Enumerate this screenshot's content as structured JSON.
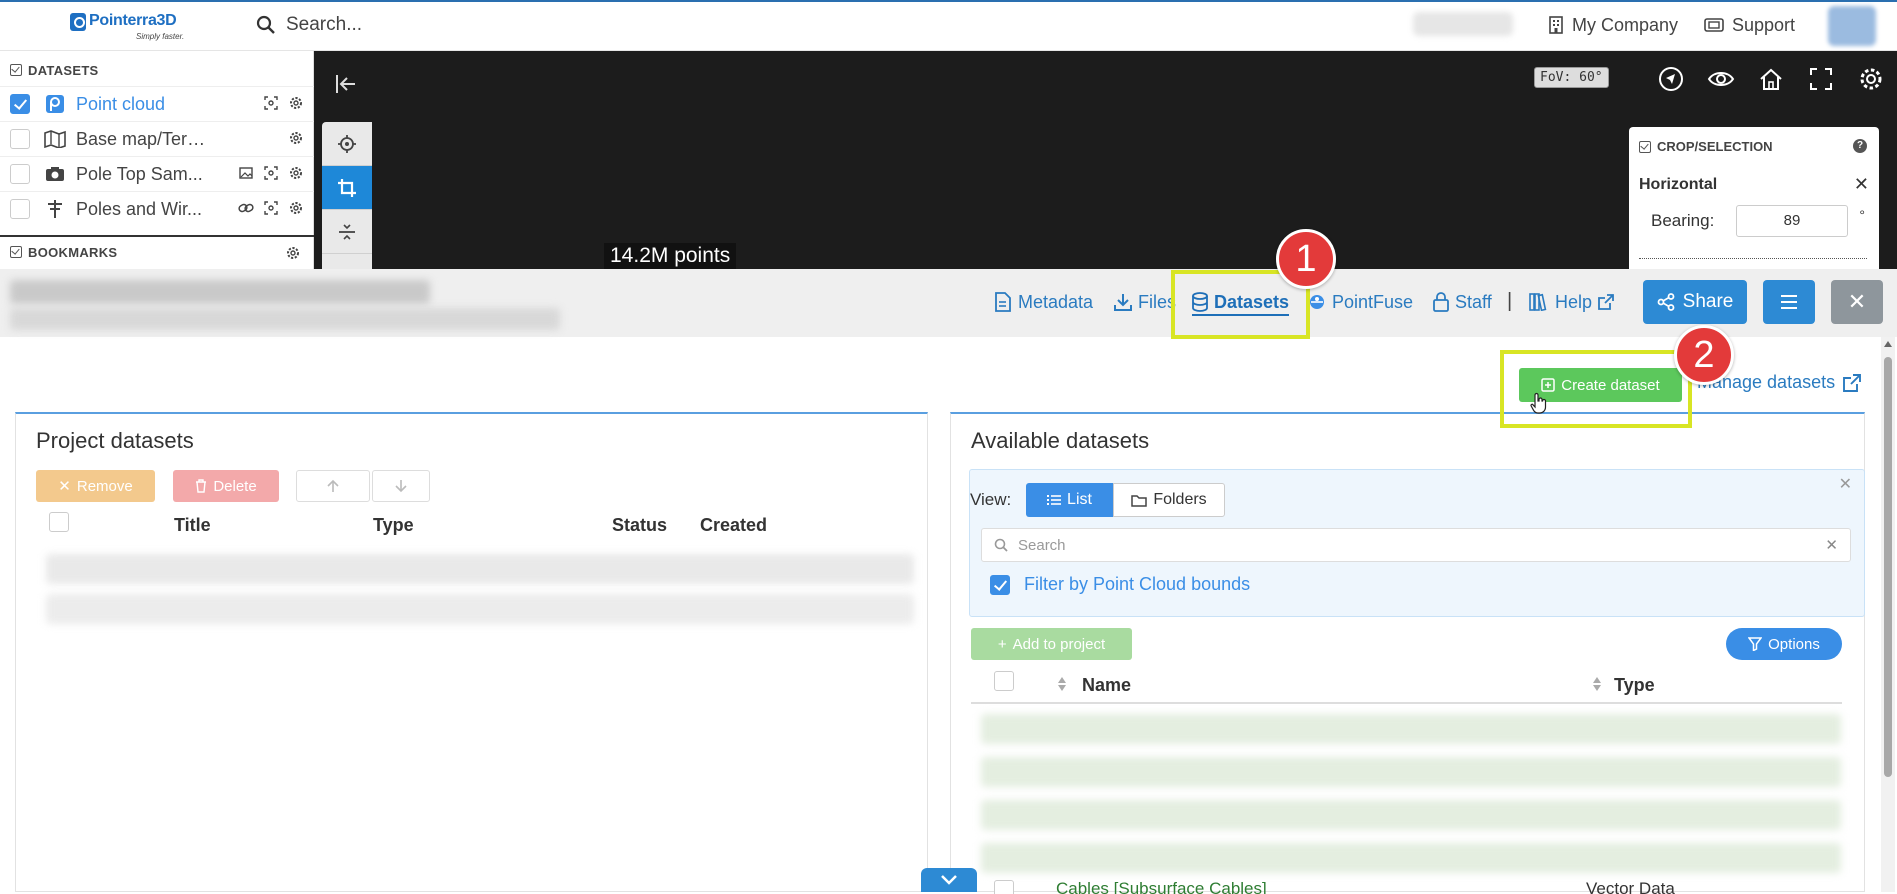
{
  "header": {
    "logo_name": "Pointerra3D",
    "logo_tagline": "Simply faster.",
    "search_placeholder": "Search...",
    "company_label": "My Company",
    "support_label": "Support"
  },
  "left_panel": {
    "datasets_heading": "DATASETS",
    "bookmarks_heading": "BOOKMARKS",
    "items": [
      {
        "label": "Point cloud",
        "checked": true,
        "icon": "point-cloud-icon"
      },
      {
        "label": "Base map/Terrain",
        "checked": false,
        "icon": "map-icon"
      },
      {
        "label": "Pole Top Sam...",
        "checked": false,
        "icon": "camera-icon"
      },
      {
        "label": "Poles and Wir...",
        "checked": false,
        "icon": "pole-icon"
      }
    ]
  },
  "viewer": {
    "points_label": "14.2M points",
    "fov_label": "FoV: 60°",
    "crop": {
      "heading": "CROP/SELECTION",
      "mode": "Horizontal",
      "bearing_label": "Bearing:",
      "bearing_value": "89",
      "bearing_unit": "°"
    }
  },
  "toolbar": {
    "tabs": {
      "metadata": "Metadata",
      "files": "Files",
      "datasets": "Datasets",
      "pointfuse": "PointFuse",
      "staff": "Staff",
      "help": "Help"
    },
    "separator": "|",
    "share_label": "Share",
    "close_label": "✕"
  },
  "annotations": {
    "step1": "1",
    "step2": "2",
    "highlight_color": "#d8e524",
    "badge_color": "#e33a3a"
  },
  "content": {
    "create_dataset_label": "Create dataset",
    "manage_datasets_label": "Manage datasets",
    "project_datasets": {
      "title": "Project datasets",
      "remove_label": "Remove",
      "delete_label": "Delete",
      "columns": [
        "Title",
        "Type",
        "Status",
        "Created"
      ]
    },
    "available_datasets": {
      "title": "Available datasets",
      "view_label": "View:",
      "list_label": "List",
      "folders_label": "Folders",
      "search_placeholder": "Search",
      "filter_label": "Filter by Point Cloud bounds",
      "filter_checked": true,
      "add_label": "Add to project",
      "options_label": "Options",
      "columns": [
        "Name",
        "Type"
      ],
      "partial_row_name": "Cables [Subsurface Cables]",
      "partial_row_type": "Vector Data"
    }
  },
  "colors": {
    "primary": "#2d8ad4",
    "success": "#5cc85c",
    "link": "#2a7bc0"
  }
}
